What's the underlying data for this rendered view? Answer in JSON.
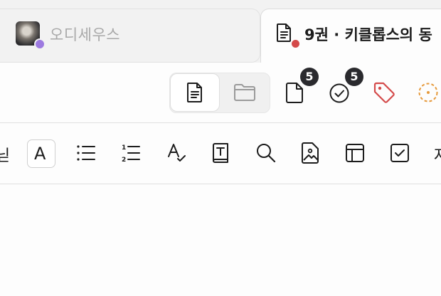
{
  "tabs": [
    {
      "title": "오디세우스",
      "status_color": "#9d7ae0",
      "icon": "avatar-image",
      "active": false
    },
    {
      "title": "9권 · 키클롭스의 동",
      "status_color": "#d44a4a",
      "icon": "document-icon",
      "active": true
    }
  ],
  "toolbar": {
    "view_toggle": {
      "options": [
        "document-icon",
        "folder-icon"
      ],
      "selected": "document-icon"
    },
    "pages_badge": "5",
    "tasks_badge": "5",
    "tag_icon_color": "#d44a4a",
    "status_icon_color": "#e69a3c"
  },
  "format_toolbar": {
    "left_edge_glyph": "닏",
    "text_style_letter": "A",
    "right_edge_glyph": "자",
    "items": [
      "text-style-icon",
      "bullet-list-icon",
      "numbered-list-icon",
      "spellcheck-icon",
      "dictionary-icon",
      "search-icon",
      "image-icon",
      "table-icon",
      "checkbox-icon"
    ]
  }
}
